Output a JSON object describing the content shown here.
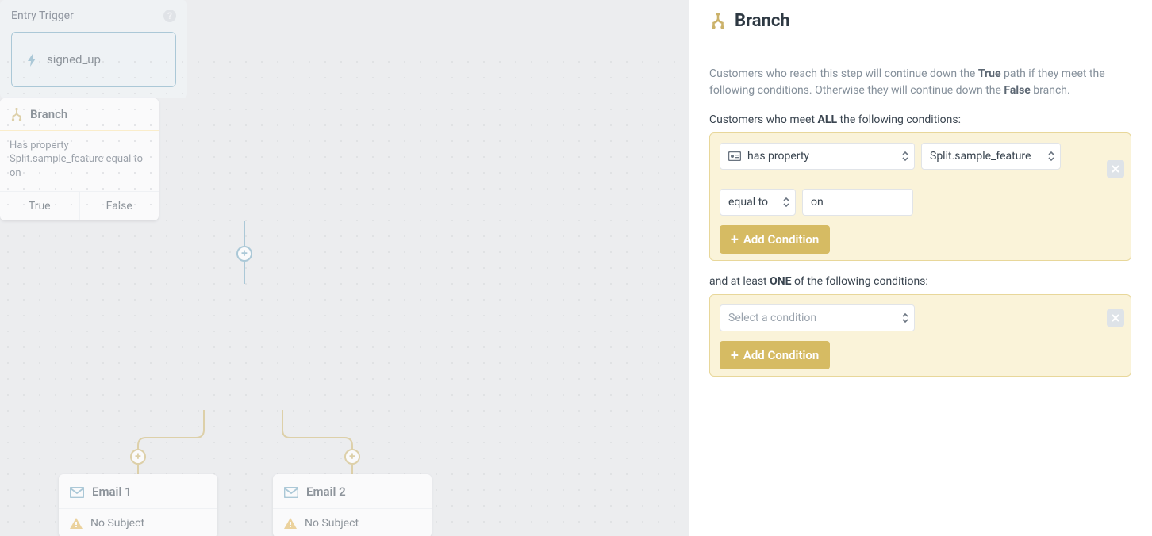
{
  "panel": {
    "title": "Branch",
    "desc_pre": "Customers who reach this step will continue down the ",
    "desc_true": "True",
    "desc_mid": " path if they meet the following conditions. Otherwise they will continue down the ",
    "desc_false": "False",
    "desc_post": " branch.",
    "sub1_pre": "Customers who meet ",
    "sub1_all": "ALL",
    "sub1_post": " the following conditions:",
    "cond1": {
      "type_label": "has property",
      "property_label": "Split.sample_feature",
      "operator_label": "equal to",
      "value": "on",
      "add_label": "Add Condition"
    },
    "sub2_pre": "and at least ",
    "sub2_one": "ONE",
    "sub2_post": " of the following conditions:",
    "cond2": {
      "placeholder": "Select a condition",
      "add_label": "Add Condition"
    }
  },
  "canvas": {
    "entry": {
      "title": "Entry Trigger",
      "trigger_label": "signed_up"
    },
    "branch": {
      "name": "Branch",
      "summary": "Has property Split.sample_feature equal to on",
      "true_label": "True",
      "false_label": "False"
    },
    "emails": [
      {
        "name": "Email 1",
        "subject": "No Subject"
      },
      {
        "name": "Email 2",
        "subject": "No Subject"
      }
    ]
  }
}
